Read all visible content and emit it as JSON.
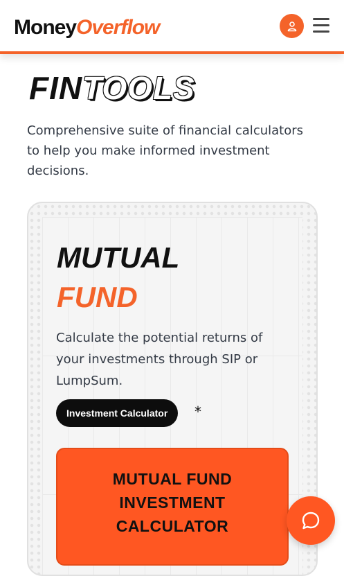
{
  "header": {
    "logo_part1": "Money",
    "logo_part2": "Overflow",
    "user_icon": "user-icon",
    "menu_icon": "hamburger-menu-icon"
  },
  "hero": {
    "title_part1": "FIN",
    "title_part2": "TOOLS",
    "description": "Comprehensive suite of financial calculators to help you make informed investment decisions."
  },
  "card": {
    "title_line1": "MUTUAL",
    "title_line2": "FUND",
    "description": "Calculate the potential returns of your investments through SIP or LumpSum.",
    "tag_label": "Investment Calculator",
    "tag_suffix": "*",
    "calculator_title_line1": "MUTUAL FUND",
    "calculator_title_line2": "INVESTMENT",
    "calculator_title_line3": "CALCULATOR"
  },
  "chat": {
    "icon": "chat-bubble-icon"
  },
  "colors": {
    "accent": "#f4632a",
    "accent_box": "#ff5722",
    "text": "#333a45",
    "dark": "#111111"
  }
}
